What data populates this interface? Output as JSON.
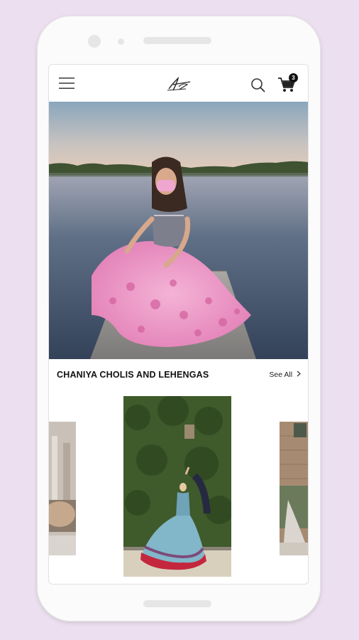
{
  "header": {
    "menu_icon": "hamburger-icon",
    "logo_icon": "signature-logo-icon",
    "search_icon": "search-icon",
    "cart_icon": "cart-icon",
    "cart_count": "3"
  },
  "section": {
    "title": "CHANIYA CHOLIS AND LEHENGAS",
    "see_all": "See All",
    "see_all_icon": "chevron-right-icon"
  },
  "colors": {
    "page_bg": "#ecdfef",
    "text": "#111111"
  }
}
